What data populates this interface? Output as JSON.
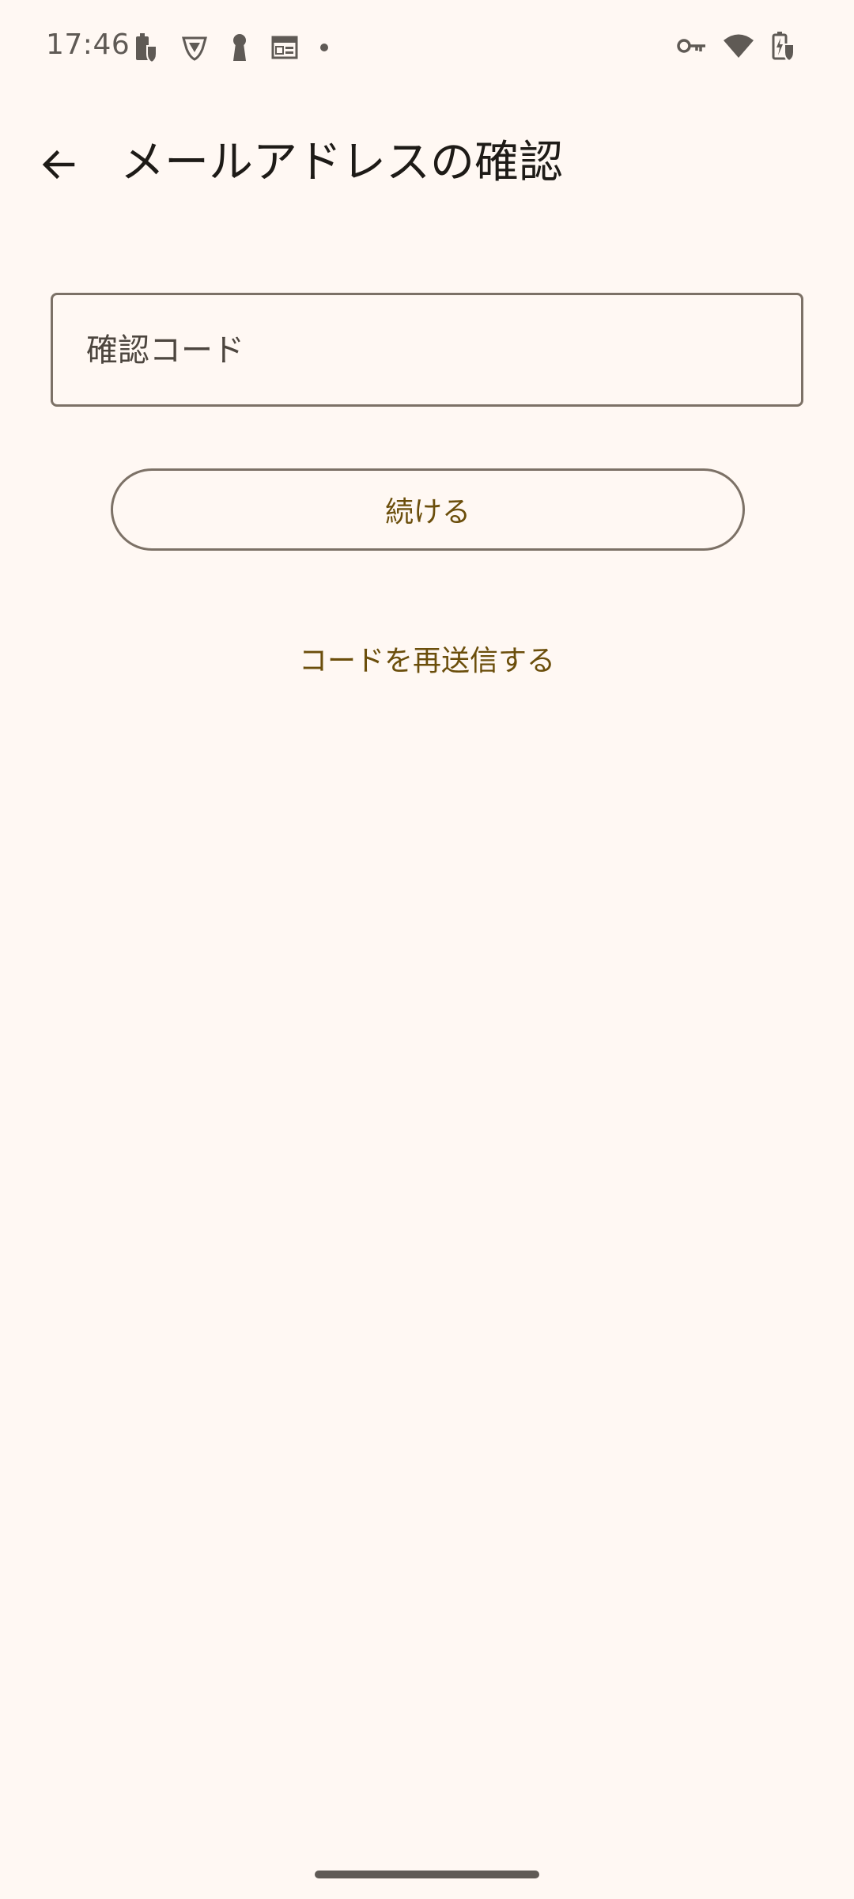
{
  "status_bar": {
    "time": "17:46"
  },
  "app_bar": {
    "title": "メールアドレスの確認"
  },
  "form": {
    "code_placeholder": "確認コード",
    "continue_label": "続ける",
    "resend_label": "コードを再送信する"
  },
  "colors": {
    "background": "#FFF8F3",
    "accent_text": "#6B4E0B",
    "outline": "#7C7166",
    "title_text": "#1E1B17"
  }
}
